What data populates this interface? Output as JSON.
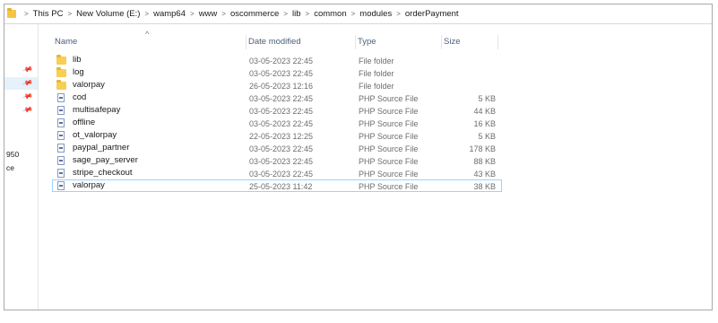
{
  "breadcrumb": [
    "This PC",
    "New Volume (E:)",
    "wamp64",
    "www",
    "oscommerce",
    "lib",
    "common",
    "modules",
    "orderPayment"
  ],
  "nav_pane": {
    "partial_labels": [
      "950",
      "ce"
    ]
  },
  "columns": {
    "name": "Name",
    "date": "Date modified",
    "type": "Type",
    "size": "Size"
  },
  "files": [
    {
      "name": "lib",
      "date": "03-05-2023 22:45",
      "type": "File folder",
      "size": "",
      "kind": "folder"
    },
    {
      "name": "log",
      "date": "03-05-2023 22:45",
      "type": "File folder",
      "size": "",
      "kind": "folder"
    },
    {
      "name": "valorpay",
      "date": "26-05-2023 12:16",
      "type": "File folder",
      "size": "",
      "kind": "folder"
    },
    {
      "name": "cod",
      "date": "03-05-2023 22:45",
      "type": "PHP Source File",
      "size": "5 KB",
      "kind": "php"
    },
    {
      "name": "multisafepay",
      "date": "03-05-2023 22:45",
      "type": "PHP Source File",
      "size": "44 KB",
      "kind": "php"
    },
    {
      "name": "offline",
      "date": "03-05-2023 22:45",
      "type": "PHP Source File",
      "size": "16 KB",
      "kind": "php"
    },
    {
      "name": "ot_valorpay",
      "date": "22-05-2023 12:25",
      "type": "PHP Source File",
      "size": "5 KB",
      "kind": "php"
    },
    {
      "name": "paypal_partner",
      "date": "03-05-2023 22:45",
      "type": "PHP Source File",
      "size": "178 KB",
      "kind": "php"
    },
    {
      "name": "sage_pay_server",
      "date": "03-05-2023 22:45",
      "type": "PHP Source File",
      "size": "88 KB",
      "kind": "php"
    },
    {
      "name": "stripe_checkout",
      "date": "03-05-2023 22:45",
      "type": "PHP Source File",
      "size": "43 KB",
      "kind": "php"
    },
    {
      "name": "valorpay",
      "date": "25-05-2023 11:42",
      "type": "PHP Source File",
      "size": "38 KB",
      "kind": "php",
      "focused": true
    }
  ]
}
